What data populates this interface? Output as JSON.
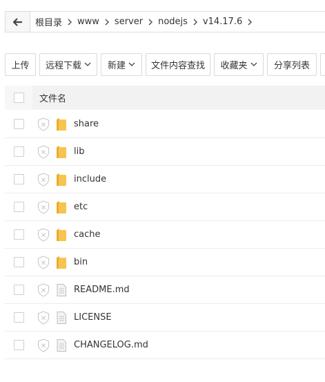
{
  "breadcrumb": {
    "items": [
      "根目录",
      "www",
      "server",
      "nodejs",
      "v14.17.6"
    ]
  },
  "toolbar": {
    "upload": "上传",
    "remote_download": "远程下载",
    "new": "新建",
    "search_content": "文件内容查找",
    "favorites": "收藏夹",
    "share_list": "分享列表"
  },
  "table": {
    "header_name": "文件名",
    "rows": [
      {
        "name": "share",
        "type": "folder"
      },
      {
        "name": "lib",
        "type": "folder"
      },
      {
        "name": "include",
        "type": "folder"
      },
      {
        "name": "etc",
        "type": "folder"
      },
      {
        "name": "cache",
        "type": "folder"
      },
      {
        "name": "bin",
        "type": "folder"
      },
      {
        "name": "README.md",
        "type": "file"
      },
      {
        "name": "LICENSE",
        "type": "file"
      },
      {
        "name": "CHANGELOG.md",
        "type": "file"
      }
    ]
  },
  "colors": {
    "folder": "#f7c44f",
    "folder_dark": "#e9ad2c",
    "border": "#dcdcdc",
    "header_bg": "#f2f2f2"
  }
}
